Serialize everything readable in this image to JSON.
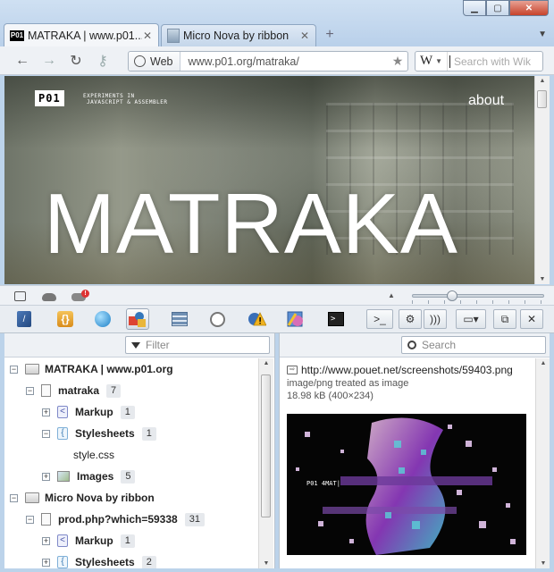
{
  "browser": {
    "tabs": [
      {
        "title": "MATRAKA | www.p01....",
        "favicon": "p01-logo-icon",
        "active": true
      },
      {
        "title": "Micro Nova by ribbon",
        "favicon": "page-icon",
        "active": false
      }
    ],
    "address": {
      "badge": "Web",
      "url": "www.p01.org/matraka/"
    },
    "search": {
      "engine": "W",
      "placeholder": "Search with Wik"
    }
  },
  "webpage": {
    "logo": "P01",
    "tagline_1": "EXPERIMENTS IN",
    "tagline_2": "JAVASCRIPT & ASSEMBLER",
    "nav_about": "about",
    "hero": "MATRAKA"
  },
  "statusbar": {
    "notification_count": "!",
    "zoom_fraction": 0.28
  },
  "devtools": {
    "filter_placeholder": "Filter",
    "search_placeholder": "Search",
    "tree": {
      "doc1": {
        "label": "MATRAKA | www.p01.org"
      },
      "dom1": {
        "label": "matraka",
        "count": "7"
      },
      "markup1": {
        "label": "Markup",
        "count": "1"
      },
      "styles1": {
        "label": "Stylesheets",
        "count": "1"
      },
      "stylefile": {
        "label": "style.css"
      },
      "images1": {
        "label": "Images",
        "count": "5"
      },
      "doc2": {
        "label": "Micro Nova by ribbon"
      },
      "dom2": {
        "label": "prod.php?which=59338",
        "count": "31"
      },
      "markup2": {
        "label": "Markup",
        "count": "1"
      },
      "styles2": {
        "label": "Stylesheets",
        "count": "2"
      }
    },
    "resource": {
      "url": "http://www.pouet.net/screenshots/59403.png",
      "mime": "image/png treated as image",
      "size": "18.98 kB (400×234)",
      "preview_caption": "P01 4MAT|"
    }
  }
}
